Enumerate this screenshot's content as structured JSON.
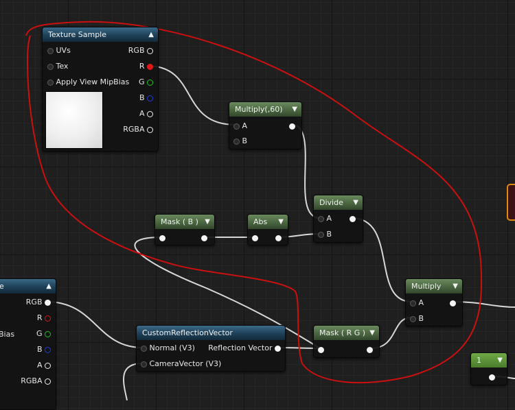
{
  "nodes": {
    "texture_sample_top": {
      "title": "Texture Sample",
      "inputs": [
        "UVs",
        "Tex",
        "Apply View MipBias"
      ],
      "outputs": [
        "RGB",
        "R",
        "G",
        "B",
        "A",
        "RGBA"
      ]
    },
    "multiply_60": {
      "title": "Multiply(,60)",
      "inputs": [
        "A",
        "B"
      ]
    },
    "divide": {
      "title": "Divide",
      "inputs": [
        "A",
        "B"
      ]
    },
    "mask_b": {
      "title": "Mask ( B )"
    },
    "abs": {
      "title": "Abs"
    },
    "multiply": {
      "title": "Multiply",
      "inputs": [
        "A",
        "B"
      ]
    },
    "texture_sample_bottom": {
      "title": "e",
      "outputs": [
        "RGB",
        "R",
        "G",
        "B",
        "A",
        "RGBA"
      ],
      "partial_input": "pBias"
    },
    "custom_reflection_vector": {
      "title": "CustomReflectionVector",
      "inputs": [
        "Normal (V3)",
        "CameraVector (V3)"
      ],
      "output": "Reflection Vector"
    },
    "mask_rg": {
      "title": "Mask ( R G )"
    },
    "constant_1": {
      "title": "1"
    }
  },
  "icons": {
    "collapse": "chevron-up-icon",
    "expand": "chevron-down-icon"
  },
  "colors": {
    "annotation_stroke": "#cc1010",
    "wire": "#d9d9d9",
    "pin_red": "#e01818",
    "pin_green": "#18c818",
    "pin_blue": "#1c3cd8",
    "orange_selection": "#e08a10"
  }
}
